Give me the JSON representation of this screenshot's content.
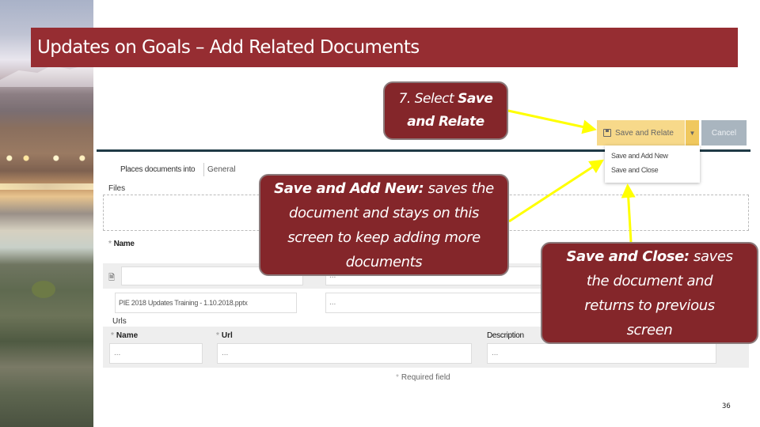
{
  "slide": {
    "title": "Updates on Goals – Add Related Documents",
    "page_number": "36",
    "colors": {
      "title_bar": "#962d32",
      "callout": "#84262a",
      "arrow": "#ffff00",
      "save_button": "#f7d98a",
      "cancel_button": "#a9b5bf"
    }
  },
  "toolbar": {
    "save_relate_label": "Save and Relate",
    "save_icon": "floppy-disk-icon",
    "split_icon": "caret-down-icon",
    "cancel_label": "Cancel",
    "dropdown_items": [
      {
        "label": "Save and Add New"
      },
      {
        "label": "Save and Close"
      }
    ]
  },
  "form": {
    "places_label": "Places documents into",
    "places_value": "General",
    "files_label": "Files",
    "name_label": "Name",
    "required_star": "*",
    "file_icon": "document-icon",
    "file_description_placeholder": "...",
    "file_name_value": "PIE 2018 Updates Training - 1.10.2018.pptx",
    "file_description2_placeholder": "...",
    "urls_label": "Urls",
    "url_columns": {
      "name": "Name",
      "url": "Url",
      "description": "Description"
    },
    "url_name_placeholder": "...",
    "url_url_placeholder": "...",
    "url_description_placeholder": "...",
    "required_note": "Required field"
  },
  "callouts": {
    "step": {
      "plain": "7. Select ",
      "bold": "Save and Relate"
    },
    "add_new": {
      "bold": "Save and Add New:",
      "text": " saves the document and stays on this screen to keep adding more documents"
    },
    "close": {
      "bold": "Save and Close:",
      "text": " saves the document and returns to previous screen"
    }
  }
}
